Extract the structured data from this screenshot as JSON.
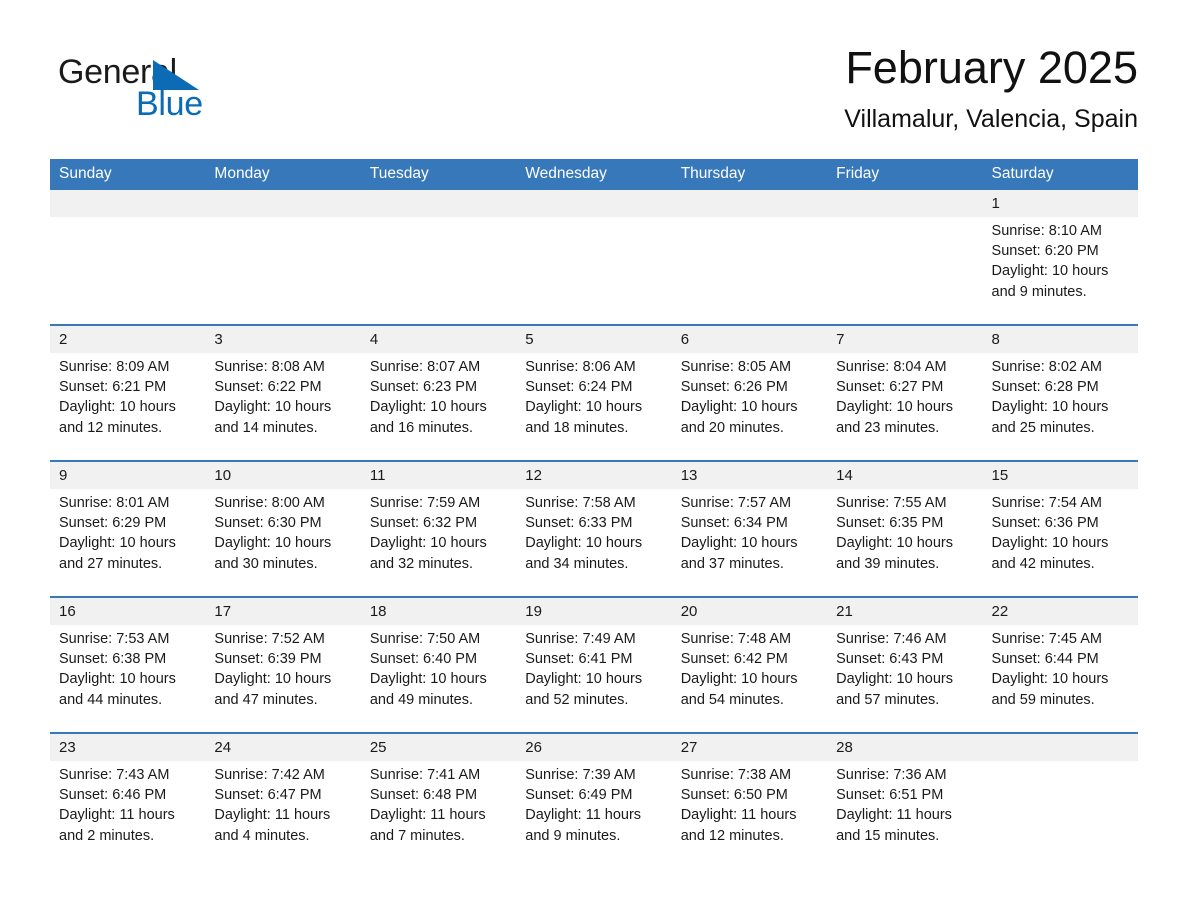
{
  "brand": {
    "name_part1": "General",
    "name_part2": "Blue",
    "accent_color": "#0b6cb5",
    "triangle_icon": "triangle-icon"
  },
  "header": {
    "month_title": "February 2025",
    "location": "Villamalur, Valencia, Spain"
  },
  "theme": {
    "header_blue": "#3678b9",
    "daynum_band": "#f1f1f1",
    "text": "#1a1a1a"
  },
  "calendar": {
    "weekday_headers": [
      "Sunday",
      "Monday",
      "Tuesday",
      "Wednesday",
      "Thursday",
      "Friday",
      "Saturday"
    ],
    "weeks": [
      {
        "days": [
          {
            "day": "",
            "sunrise": "",
            "sunset": "",
            "daylight": "",
            "empty": true
          },
          {
            "day": "",
            "sunrise": "",
            "sunset": "",
            "daylight": "",
            "empty": true
          },
          {
            "day": "",
            "sunrise": "",
            "sunset": "",
            "daylight": "",
            "empty": true
          },
          {
            "day": "",
            "sunrise": "",
            "sunset": "",
            "daylight": "",
            "empty": true
          },
          {
            "day": "",
            "sunrise": "",
            "sunset": "",
            "daylight": "",
            "empty": true
          },
          {
            "day": "",
            "sunrise": "",
            "sunset": "",
            "daylight": "",
            "empty": true
          },
          {
            "day": "1",
            "sunrise": "Sunrise: 8:10 AM",
            "sunset": "Sunset: 6:20 PM",
            "daylight": "Daylight: 10 hours and 9 minutes.",
            "empty": false
          }
        ]
      },
      {
        "days": [
          {
            "day": "2",
            "sunrise": "Sunrise: 8:09 AM",
            "sunset": "Sunset: 6:21 PM",
            "daylight": "Daylight: 10 hours and 12 minutes.",
            "empty": false
          },
          {
            "day": "3",
            "sunrise": "Sunrise: 8:08 AM",
            "sunset": "Sunset: 6:22 PM",
            "daylight": "Daylight: 10 hours and 14 minutes.",
            "empty": false
          },
          {
            "day": "4",
            "sunrise": "Sunrise: 8:07 AM",
            "sunset": "Sunset: 6:23 PM",
            "daylight": "Daylight: 10 hours and 16 minutes.",
            "empty": false
          },
          {
            "day": "5",
            "sunrise": "Sunrise: 8:06 AM",
            "sunset": "Sunset: 6:24 PM",
            "daylight": "Daylight: 10 hours and 18 minutes.",
            "empty": false
          },
          {
            "day": "6",
            "sunrise": "Sunrise: 8:05 AM",
            "sunset": "Sunset: 6:26 PM",
            "daylight": "Daylight: 10 hours and 20 minutes.",
            "empty": false
          },
          {
            "day": "7",
            "sunrise": "Sunrise: 8:04 AM",
            "sunset": "Sunset: 6:27 PM",
            "daylight": "Daylight: 10 hours and 23 minutes.",
            "empty": false
          },
          {
            "day": "8",
            "sunrise": "Sunrise: 8:02 AM",
            "sunset": "Sunset: 6:28 PM",
            "daylight": "Daylight: 10 hours and 25 minutes.",
            "empty": false
          }
        ]
      },
      {
        "days": [
          {
            "day": "9",
            "sunrise": "Sunrise: 8:01 AM",
            "sunset": "Sunset: 6:29 PM",
            "daylight": "Daylight: 10 hours and 27 minutes.",
            "empty": false
          },
          {
            "day": "10",
            "sunrise": "Sunrise: 8:00 AM",
            "sunset": "Sunset: 6:30 PM",
            "daylight": "Daylight: 10 hours and 30 minutes.",
            "empty": false
          },
          {
            "day": "11",
            "sunrise": "Sunrise: 7:59 AM",
            "sunset": "Sunset: 6:32 PM",
            "daylight": "Daylight: 10 hours and 32 minutes.",
            "empty": false
          },
          {
            "day": "12",
            "sunrise": "Sunrise: 7:58 AM",
            "sunset": "Sunset: 6:33 PM",
            "daylight": "Daylight: 10 hours and 34 minutes.",
            "empty": false
          },
          {
            "day": "13",
            "sunrise": "Sunrise: 7:57 AM",
            "sunset": "Sunset: 6:34 PM",
            "daylight": "Daylight: 10 hours and 37 minutes.",
            "empty": false
          },
          {
            "day": "14",
            "sunrise": "Sunrise: 7:55 AM",
            "sunset": "Sunset: 6:35 PM",
            "daylight": "Daylight: 10 hours and 39 minutes.",
            "empty": false
          },
          {
            "day": "15",
            "sunrise": "Sunrise: 7:54 AM",
            "sunset": "Sunset: 6:36 PM",
            "daylight": "Daylight: 10 hours and 42 minutes.",
            "empty": false
          }
        ]
      },
      {
        "days": [
          {
            "day": "16",
            "sunrise": "Sunrise: 7:53 AM",
            "sunset": "Sunset: 6:38 PM",
            "daylight": "Daylight: 10 hours and 44 minutes.",
            "empty": false
          },
          {
            "day": "17",
            "sunrise": "Sunrise: 7:52 AM",
            "sunset": "Sunset: 6:39 PM",
            "daylight": "Daylight: 10 hours and 47 minutes.",
            "empty": false
          },
          {
            "day": "18",
            "sunrise": "Sunrise: 7:50 AM",
            "sunset": "Sunset: 6:40 PM",
            "daylight": "Daylight: 10 hours and 49 minutes.",
            "empty": false
          },
          {
            "day": "19",
            "sunrise": "Sunrise: 7:49 AM",
            "sunset": "Sunset: 6:41 PM",
            "daylight": "Daylight: 10 hours and 52 minutes.",
            "empty": false
          },
          {
            "day": "20",
            "sunrise": "Sunrise: 7:48 AM",
            "sunset": "Sunset: 6:42 PM",
            "daylight": "Daylight: 10 hours and 54 minutes.",
            "empty": false
          },
          {
            "day": "21",
            "sunrise": "Sunrise: 7:46 AM",
            "sunset": "Sunset: 6:43 PM",
            "daylight": "Daylight: 10 hours and 57 minutes.",
            "empty": false
          },
          {
            "day": "22",
            "sunrise": "Sunrise: 7:45 AM",
            "sunset": "Sunset: 6:44 PM",
            "daylight": "Daylight: 10 hours and 59 minutes.",
            "empty": false
          }
        ]
      },
      {
        "days": [
          {
            "day": "23",
            "sunrise": "Sunrise: 7:43 AM",
            "sunset": "Sunset: 6:46 PM",
            "daylight": "Daylight: 11 hours and 2 minutes.",
            "empty": false
          },
          {
            "day": "24",
            "sunrise": "Sunrise: 7:42 AM",
            "sunset": "Sunset: 6:47 PM",
            "daylight": "Daylight: 11 hours and 4 minutes.",
            "empty": false
          },
          {
            "day": "25",
            "sunrise": "Sunrise: 7:41 AM",
            "sunset": "Sunset: 6:48 PM",
            "daylight": "Daylight: 11 hours and 7 minutes.",
            "empty": false
          },
          {
            "day": "26",
            "sunrise": "Sunrise: 7:39 AM",
            "sunset": "Sunset: 6:49 PM",
            "daylight": "Daylight: 11 hours and 9 minutes.",
            "empty": false
          },
          {
            "day": "27",
            "sunrise": "Sunrise: 7:38 AM",
            "sunset": "Sunset: 6:50 PM",
            "daylight": "Daylight: 11 hours and 12 minutes.",
            "empty": false
          },
          {
            "day": "28",
            "sunrise": "Sunrise: 7:36 AM",
            "sunset": "Sunset: 6:51 PM",
            "daylight": "Daylight: 11 hours and 15 minutes.",
            "empty": false
          },
          {
            "day": "",
            "sunrise": "",
            "sunset": "",
            "daylight": "",
            "empty": true
          }
        ]
      }
    ]
  }
}
